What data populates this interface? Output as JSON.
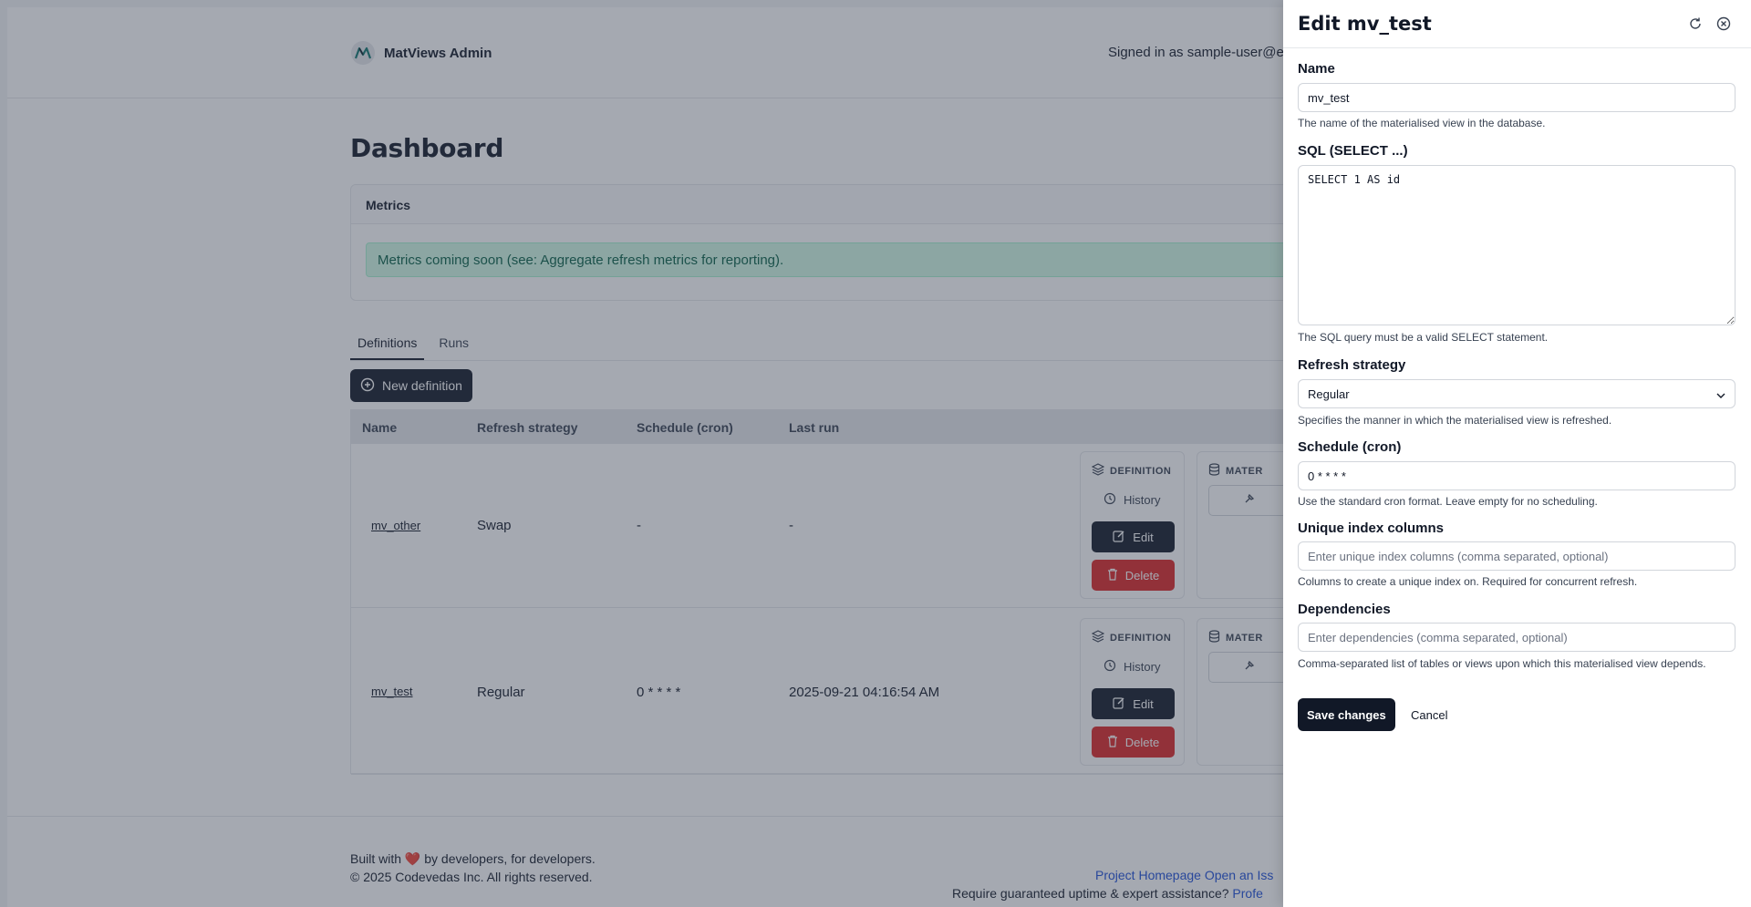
{
  "header": {
    "brand_name": "MatViews Admin",
    "signed_in": "Signed in as sample-user@e"
  },
  "dashboard": {
    "title": "Dashboard",
    "metrics_title": "Metrics",
    "metrics_note": "Metrics coming soon (see: Aggregate refresh metrics for reporting).",
    "tabs": [
      {
        "label": "Definitions",
        "active": true
      },
      {
        "label": "Runs",
        "active": false
      }
    ],
    "new_definition_label": "New definition",
    "columns": [
      "Name",
      "Refresh strategy",
      "Schedule (cron)",
      "Last run"
    ],
    "rows": [
      {
        "name": "mv_other",
        "strategy": "Swap",
        "schedule": "-",
        "last_run": "-"
      },
      {
        "name": "mv_test",
        "strategy": "Regular",
        "schedule": "0 * * * *",
        "last_run": "2025-09-21 04:16:54 AM"
      }
    ],
    "definition_label": "DEFINITION",
    "materialised_label": "MATER",
    "history_label": "History",
    "edit_label": "Edit",
    "delete_label": "Delete"
  },
  "footer": {
    "line1_prefix": "Built with",
    "line1_suffix": "by developers, for developers.",
    "line2": "© 2025 Codevedas Inc. All rights reserved.",
    "links_line": "Project Homepage Open an Iss",
    "support_prefix": "Require guaranteed uptime & expert assistance?",
    "support_link": "Profe"
  },
  "drawer": {
    "title": "Edit mv_test",
    "name_label": "Name",
    "name_value": "mv_test",
    "name_help": "The name of the materialised view in the database.",
    "sql_label": "SQL (SELECT ...)",
    "sql_value": "SELECT 1 AS id",
    "sql_help": "The SQL query must be a valid SELECT statement.",
    "strategy_label": "Refresh strategy",
    "strategy_value": "Regular",
    "strategy_help": "Specifies the manner in which the materialised view is refreshed.",
    "schedule_label": "Schedule (cron)",
    "schedule_value": "0 * * * *",
    "schedule_help": "Use the standard cron format. Leave empty for no scheduling.",
    "unique_label": "Unique index columns",
    "unique_placeholder": "Enter unique index columns (comma separated, optional)",
    "unique_help": "Columns to create a unique index on. Required for concurrent refresh.",
    "deps_label": "Dependencies",
    "deps_placeholder": "Enter dependencies (comma separated, optional)",
    "deps_help": "Comma-separated list of tables or views upon which this materialised view depends.",
    "save_label": "Save changes",
    "cancel_label": "Cancel"
  },
  "colors": {
    "primary": "#111827",
    "danger": "#dc2626",
    "success_bg": "#d1fae5",
    "link": "#1d4ed8"
  }
}
